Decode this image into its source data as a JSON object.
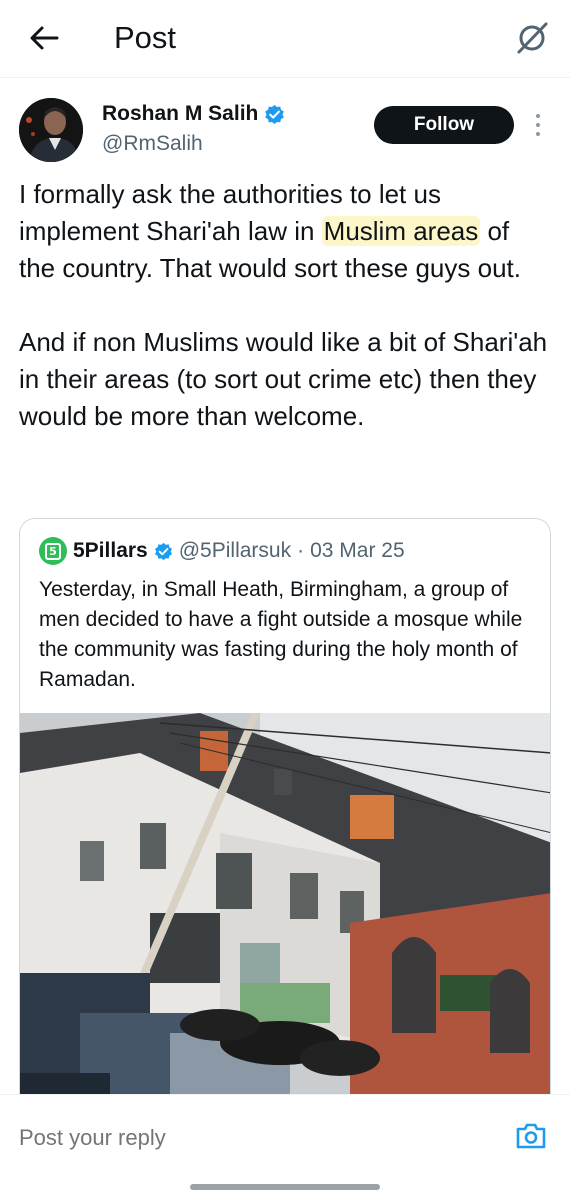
{
  "header": {
    "title": "Post",
    "back_icon": "arrow-left-icon",
    "grok_icon": "grok-icon"
  },
  "author": {
    "name": "Roshan M Salih",
    "handle": "@RmSalih",
    "verified": true,
    "follow_label": "Follow"
  },
  "tweet": {
    "text_before": "I formally ask the authorities to let us implement Shari'ah law in ",
    "highlight": "Muslim areas",
    "text_after": " of the country. That would sort these guys out.\n\nAnd if non Muslims would like a bit of Shari'ah in their areas (to sort out crime etc) then they would be more than welcome."
  },
  "quote": {
    "name": "5Pillars",
    "handle": "@5Pillarsuk",
    "separator": "·",
    "date": "03 Mar 25",
    "logo_text": "5",
    "text": "Yesterday, in Small Heath, Birmingham, a group of men decided to have a fight outside a mosque while the community was fasting during the holy month of Ramadan."
  },
  "reply": {
    "placeholder": "Post your reply",
    "camera_icon": "camera-icon"
  },
  "colors": {
    "text": "#0f1419",
    "secondary": "#536471",
    "verified": "#1d9bf0",
    "highlight": "#fdf6c9",
    "brand_green": "#2ebd59"
  }
}
